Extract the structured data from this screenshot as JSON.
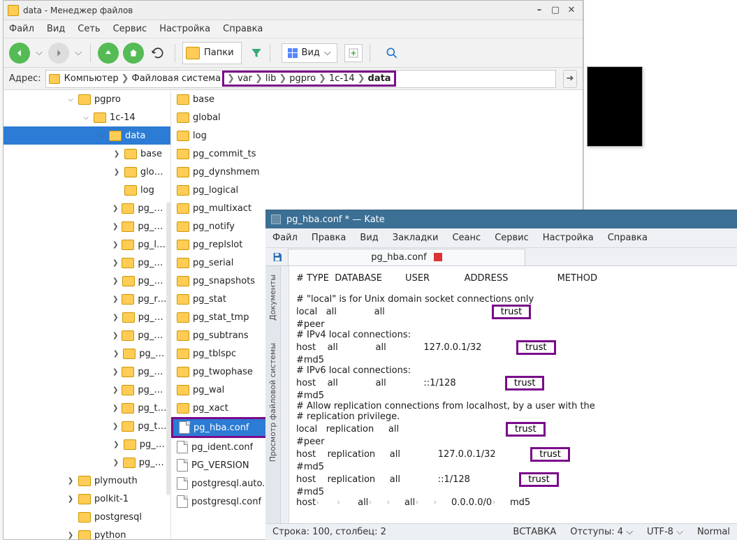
{
  "fm": {
    "window_title": "data - Менеджер файлов",
    "menu": [
      "Файл",
      "Вид",
      "Сеть",
      "Сервис",
      "Настройка",
      "Справка"
    ],
    "toolbar": {
      "folders_label": "Папки",
      "view_label": "Вид"
    },
    "address_label": "Адрес:",
    "breadcrumb": {
      "root": "Компьютер",
      "fs": "Файловая система",
      "pathparts": [
        "var",
        "lib",
        "pgpro",
        "1c-14"
      ],
      "current": "data"
    },
    "tree": [
      {
        "depth": 0,
        "exp": "v",
        "name": "pgpro"
      },
      {
        "depth": 1,
        "exp": "v",
        "name": "1c-14"
      },
      {
        "depth": 2,
        "exp": "v",
        "name": "data",
        "selected": true
      },
      {
        "depth": 3,
        "exp": ">",
        "name": "base"
      },
      {
        "depth": 3,
        "exp": ">",
        "name": "global"
      },
      {
        "depth": 3,
        "exp": "",
        "name": "log"
      },
      {
        "depth": 3,
        "exp": ">",
        "name": "pg_commit_ts"
      },
      {
        "depth": 3,
        "exp": ">",
        "name": "pg_dynshmem"
      },
      {
        "depth": 3,
        "exp": ">",
        "name": "pg_logical"
      },
      {
        "depth": 3,
        "exp": ">",
        "name": "pg_multixact"
      },
      {
        "depth": 3,
        "exp": ">",
        "name": "pg_notify"
      },
      {
        "depth": 3,
        "exp": ">",
        "name": "pg_replslot"
      },
      {
        "depth": 3,
        "exp": ">",
        "name": "pg_serial"
      },
      {
        "depth": 3,
        "exp": ">",
        "name": "pg_snapshots"
      },
      {
        "depth": 3,
        "exp": ">",
        "name": "pg_stat"
      },
      {
        "depth": 3,
        "exp": ">",
        "name": "pg_stat_tmp"
      },
      {
        "depth": 3,
        "exp": ">",
        "name": "pg_subtrans"
      },
      {
        "depth": 3,
        "exp": ">",
        "name": "pg_tblspc"
      },
      {
        "depth": 3,
        "exp": ">",
        "name": "pg_twophase"
      },
      {
        "depth": 3,
        "exp": ">",
        "name": "pg_wal"
      },
      {
        "depth": 3,
        "exp": ">",
        "name": "pg_xact"
      },
      {
        "depth": 0,
        "exp": ">",
        "name": "plymouth"
      },
      {
        "depth": 0,
        "exp": ">",
        "name": "polkit-1"
      },
      {
        "depth": 0,
        "exp": "",
        "name": "postgresql"
      },
      {
        "depth": 0,
        "exp": ">",
        "name": "python"
      }
    ],
    "list": [
      {
        "type": "folder",
        "name": "base"
      },
      {
        "type": "folder",
        "name": "global"
      },
      {
        "type": "folder",
        "name": "log"
      },
      {
        "type": "folder",
        "name": "pg_commit_ts"
      },
      {
        "type": "folder",
        "name": "pg_dynshmem"
      },
      {
        "type": "folder",
        "name": "pg_logical"
      },
      {
        "type": "folder",
        "name": "pg_multixact"
      },
      {
        "type": "folder",
        "name": "pg_notify"
      },
      {
        "type": "folder",
        "name": "pg_replslot"
      },
      {
        "type": "folder",
        "name": "pg_serial"
      },
      {
        "type": "folder",
        "name": "pg_snapshots"
      },
      {
        "type": "folder",
        "name": "pg_stat"
      },
      {
        "type": "folder",
        "name": "pg_stat_tmp"
      },
      {
        "type": "folder",
        "name": "pg_subtrans"
      },
      {
        "type": "folder",
        "name": "pg_tblspc"
      },
      {
        "type": "folder",
        "name": "pg_twophase"
      },
      {
        "type": "folder",
        "name": "pg_wal"
      },
      {
        "type": "folder",
        "name": "pg_xact"
      },
      {
        "type": "file",
        "name": "pg_hba.conf",
        "highlight": true
      },
      {
        "type": "file",
        "name": "pg_ident.conf"
      },
      {
        "type": "file",
        "name": "PG_VERSION"
      },
      {
        "type": "file",
        "name": "postgresql.auto.conf"
      },
      {
        "type": "file",
        "name": "postgresql.conf"
      }
    ]
  },
  "kate": {
    "window_title": "pg_hba.conf * — Kate",
    "menu": [
      "Файл",
      "Правка",
      "Вид",
      "Закладки",
      "Сеанс",
      "Сервис",
      "Настройка",
      "Справка"
    ],
    "tab": "pg_hba.conf",
    "side_labels": [
      "Документы",
      "Просмотр файловой системы"
    ],
    "lines": [
      "# TYPE  DATABASE        USER            ADDRESS                 METHOD",
      "",
      "# \"local\" is for Unix domain socket connections only",
      "local   all             all                                     [[trust]]",
      "#peer",
      "# IPv4 local connections:",
      "host    all             all             127.0.0.1/32            [[trust]]",
      "#md5",
      "# IPv6 local connections:",
      "host    all             all             ::1/128                 [[trust]]",
      "#md5",
      "# Allow replication connections from localhost, by a user with the",
      "# replication privilege.",
      "local   replication     all                                     [[trust]]",
      "#peer",
      "host    replication     all             127.0.0.1/32            [[trust]]",
      "#md5",
      "host    replication     all             ::1/128                 [[trust]]",
      "#md5",
      "host›   ›   all›  ›  all›  ›  0.0.0.0/0›  md5"
    ],
    "status": {
      "pos": "Строка: 100, столбец: 2",
      "insert": "ВСТАВКА",
      "indent_lbl": "Отступы:",
      "indent_val": "4",
      "enc": "UTF-8",
      "mode": "Normal"
    }
  }
}
